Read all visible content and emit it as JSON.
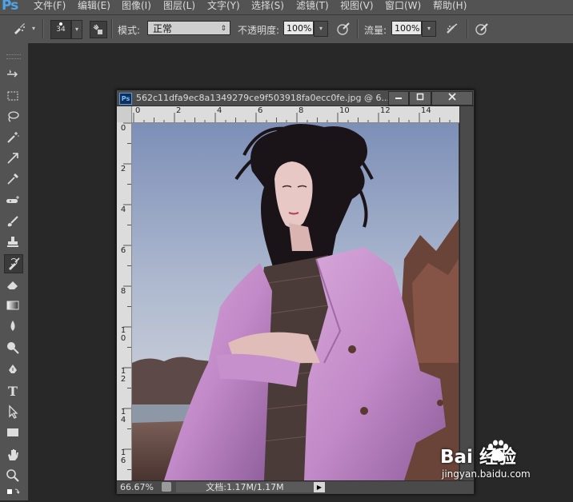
{
  "app": {
    "logo": "Ps"
  },
  "menu": [
    "文件(F)",
    "编辑(E)",
    "图像(I)",
    "图层(L)",
    "文字(Y)",
    "选择(S)",
    "滤镜(T)",
    "视图(V)",
    "窗口(W)",
    "帮助(H)"
  ],
  "options": {
    "brush_size": "34",
    "mode_label": "模式:",
    "mode_value": "正常",
    "opacity_label": "不透明度:",
    "opacity_value": "100%",
    "flow_label": "流量:",
    "flow_value": "100%"
  },
  "tools": [
    "move-icon",
    "marquee-icon",
    "lasso-icon",
    "magic-wand-icon",
    "crop-icon",
    "eyedropper-icon",
    "spot-healing-icon",
    "brush-icon",
    "clone-stamp-icon",
    "history-brush-icon",
    "eraser-icon",
    "gradient-icon",
    "blur-icon",
    "dodge-icon",
    "pen-icon",
    "type-icon",
    "path-selection-icon",
    "rectangle-icon",
    "hand-icon",
    "zoom-icon",
    "swap-colors-icon"
  ],
  "document": {
    "title": "562c11dfa9ec8a1349279ce9f503918fa0ecc0fe.jpg @ 6...",
    "ruler_top": [
      "0",
      "2",
      "4",
      "6",
      "8",
      "10",
      "12",
      "14"
    ],
    "ruler_left": [
      "0",
      "2",
      "4",
      "6",
      "8",
      "10",
      "12",
      "14",
      "16"
    ],
    "zoom": "66.67%",
    "doc_info": "文档:1.17M/1.17M"
  },
  "watermark": {
    "brand": "Bai  经验",
    "url": "jingyan.baidu.com"
  },
  "colors": {
    "panel": "#535353",
    "workspace": "#282828",
    "ps_blue": "#4fa3e8"
  }
}
